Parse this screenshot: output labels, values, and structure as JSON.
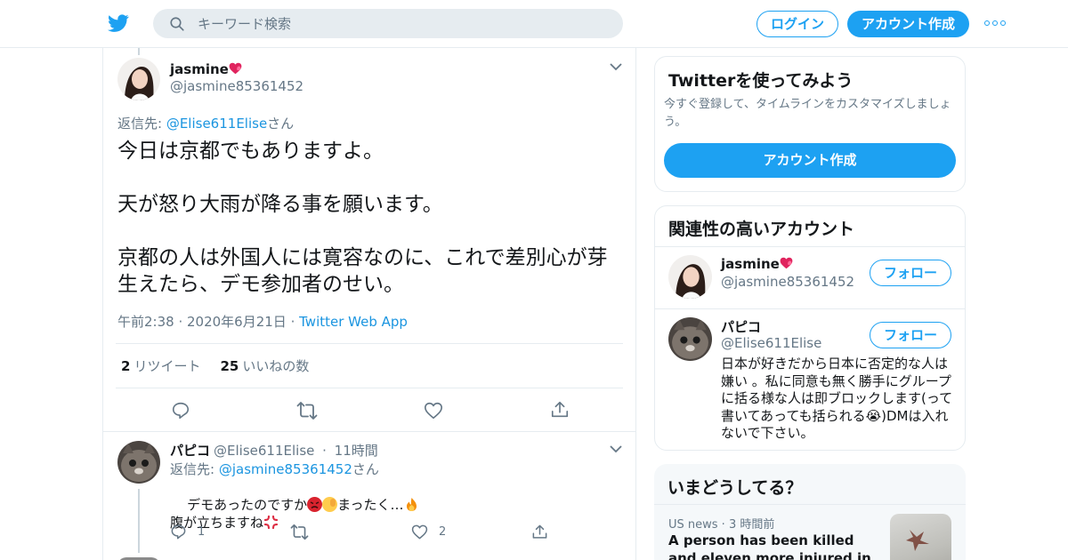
{
  "colors": {
    "accent": "#1da1f2",
    "link": "#1b95e0",
    "muted": "#657786",
    "border": "#e6ecf0"
  },
  "topbar": {
    "logo_icon": "twitter-bird-icon",
    "search": {
      "placeholder": "キーワード検索",
      "value": ""
    },
    "login_label": "ログイン",
    "signup_label": "アカウント作成",
    "more_icon": "more-dots-icon"
  },
  "focus_tweet": {
    "name": "jasmine",
    "name_emoji": "💕",
    "handle": "@jasmine85361452",
    "reply_prefix": "返信先: ",
    "reply_handle": "@Elise611Elise",
    "reply_suffix": "さん",
    "text": "今日は京都でもありますよ。\n\n天が怒り大雨が降る事を願います。\n\n京都の人は外国人には寛容なのに、これで差別心が芽生えたら、デモ参加者のせい。",
    "time": "午前2:38",
    "date": "2020年6月21日",
    "source": "Twitter Web App",
    "retweet_count": "2",
    "retweet_label": "リツイート",
    "like_count": "25",
    "like_label": "いいねの数"
  },
  "reply_tweet": {
    "name": "パピコ",
    "handle": "@Elise611Elise",
    "time": "11時間",
    "reply_prefix": "返信先: ",
    "reply_handle": "@jasmine85361452",
    "reply_suffix": "さん",
    "text_part1": "デモあったのですか",
    "text_part2": "まったく…",
    "text_line2": "腹が立ちますね",
    "reply_count": "1",
    "like_count": "2"
  },
  "sidebar": {
    "signup_card": {
      "title": "Twitterを使ってみよう",
      "description": "今すぐ登録して、タイムラインをカスタマイズしましょう。",
      "button": "アカウント作成"
    },
    "related": {
      "title": "関連性の高いアカウント",
      "accounts": [
        {
          "name": "jasmine",
          "name_emoji": "💕",
          "handle": "@jasmine85361452",
          "follow": "フォロー"
        },
        {
          "name": "パピコ",
          "handle": "@Elise611Elise",
          "follow": "フォロー",
          "bio": "日本が好きだから日本に否定的な人は嫌い 。私に同意も無く勝手にグループに括る様な人は即ブロックします(って書いてあっても括られる😭)DMは入れないで下さい。"
        }
      ]
    },
    "trends": {
      "title": "いまどうしてる？",
      "meta_source": "US news",
      "meta_time": "3 時間前",
      "headline": "A person has been killed and eleven more injured in a shooting in"
    }
  }
}
